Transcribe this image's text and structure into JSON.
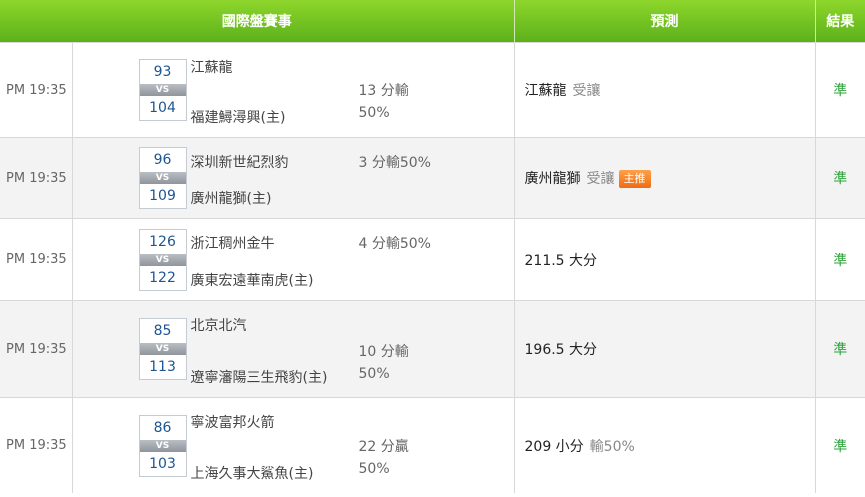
{
  "header": {
    "match_col": "國際盤賽事",
    "prediction_col": "預測",
    "result_col": "結果"
  },
  "rows": [
    {
      "time": "PM 19:35",
      "away_score": "93",
      "vs": "VS",
      "home_score": "104",
      "away_team": "江蘇龍",
      "home_team": "福建鱘潯興(主)",
      "handicap_line1": "13 分輸",
      "handicap_line2": "50%",
      "prediction": "江蘇龍",
      "prediction_note": "受讓",
      "badge": "",
      "result": "準"
    },
    {
      "time": "PM 19:35",
      "away_score": "96",
      "vs": "VS",
      "home_score": "109",
      "away_team": "深圳新世紀烈豹",
      "home_team": "廣州龍獅(主)",
      "handicap_line1": "3 分輸50%",
      "handicap_line2": "",
      "prediction": "廣州龍獅",
      "prediction_note": "受讓",
      "badge": "主推",
      "result": "準"
    },
    {
      "time": "PM 19:35",
      "away_score": "126",
      "vs": "VS",
      "home_score": "122",
      "away_team": "浙江稠州金牛",
      "home_team": "廣東宏遠華南虎(主)",
      "handicap_line1": "4 分輸50%",
      "handicap_line2": "",
      "prediction": "211.5 大分",
      "prediction_note": "",
      "badge": "",
      "result": "準"
    },
    {
      "time": "PM 19:35",
      "away_score": "85",
      "vs": "VS",
      "home_score": "113",
      "away_team": "北京北汽",
      "home_team": "遼寧瀋陽三生飛豹(主)",
      "handicap_line1": "10 分輸",
      "handicap_line2": "50%",
      "prediction": "196.5 大分",
      "prediction_note": "",
      "badge": "",
      "result": "準"
    },
    {
      "time": "PM 19:35",
      "away_score": "86",
      "vs": "VS",
      "home_score": "103",
      "away_team": "寧波富邦火箭",
      "home_team": "上海久事大鯊魚(主)",
      "handicap_line1": "22 分贏",
      "handicap_line2": "50%",
      "prediction": "209 小分",
      "prediction_note": "輸50%",
      "badge": "",
      "result": "準"
    }
  ]
}
